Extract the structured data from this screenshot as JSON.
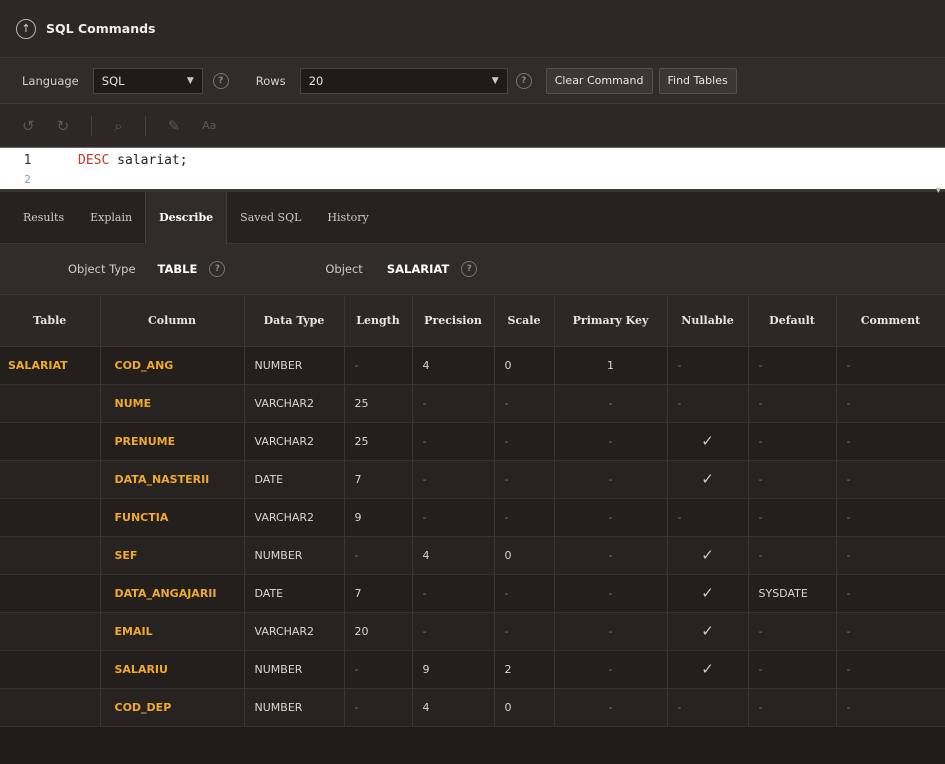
{
  "header": {
    "title": "SQL Commands"
  },
  "toolbar": {
    "language_label": "Language",
    "language_value": "SQL",
    "rows_label": "Rows",
    "rows_value": "20",
    "clear_button": "Clear Command",
    "find_button": "Find Tables",
    "help_glyph": "?"
  },
  "editor": {
    "lines": [
      {
        "num": "1",
        "keyword": "DESC",
        "rest": " salariat;"
      },
      {
        "num": "2",
        "keyword": "",
        "rest": ""
      }
    ]
  },
  "tabs": [
    "Results",
    "Explain",
    "Describe",
    "Saved SQL",
    "History"
  ],
  "object_info": {
    "type_label": "Object Type",
    "type_value": "TABLE",
    "object_label": "Object",
    "object_value": "SALARIAT"
  },
  "table": {
    "headers": [
      "Table",
      "Column",
      "Data Type",
      "Length",
      "Precision",
      "Scale",
      "Primary Key",
      "Nullable",
      "Default",
      "Comment"
    ],
    "rows": [
      [
        "SALARIAT",
        "COD_ANG",
        "NUMBER",
        "-",
        "4",
        "0",
        "1",
        "-",
        "-",
        "-"
      ],
      [
        "",
        "NUME",
        "VARCHAR2",
        "25",
        "-",
        "-",
        "-",
        "-",
        "-",
        "-"
      ],
      [
        "",
        "PRENUME",
        "VARCHAR2",
        "25",
        "-",
        "-",
        "-",
        "✓",
        "-",
        "-"
      ],
      [
        "",
        "DATA_NASTERII",
        "DATE",
        "7",
        "-",
        "-",
        "-",
        "✓",
        "-",
        "-"
      ],
      [
        "",
        "FUNCTIA",
        "VARCHAR2",
        "9",
        "-",
        "-",
        "-",
        "-",
        "-",
        "-"
      ],
      [
        "",
        "SEF",
        "NUMBER",
        "-",
        "4",
        "0",
        "-",
        "✓",
        "-",
        "-"
      ],
      [
        "",
        "DATA_ANGAJARII",
        "DATE",
        "7",
        "-",
        "-",
        "-",
        "✓",
        "SYSDATE",
        "-"
      ],
      [
        "",
        "EMAIL",
        "VARCHAR2",
        "20",
        "-",
        "-",
        "-",
        "✓",
        "-",
        "-"
      ],
      [
        "",
        "SALARIU",
        "NUMBER",
        "-",
        "9",
        "2",
        "-",
        "✓",
        "-",
        "-"
      ],
      [
        "",
        "COD_DEP",
        "NUMBER",
        "-",
        "4",
        "0",
        "-",
        "-",
        "-",
        "-"
      ]
    ]
  },
  "colors": {
    "accent": "#f0a830",
    "background": "#1f1c19"
  }
}
